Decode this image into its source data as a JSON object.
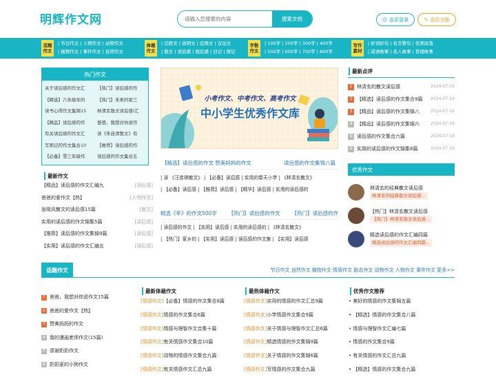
{
  "header": {
    "logo": "明辉作文网",
    "search_placeholder": "请输入您搜索的内容",
    "search_button": "搜索文档",
    "login": "会员登录",
    "register": "会员注册"
  },
  "nav": [
    {
      "tag": "话题作文",
      "links": [
        "| 节日作文 | 人物作文 | 动物作文",
        "| 植物作文 | 事件作文 | 自然作文"
      ]
    },
    {
      "tag": "体裁作文",
      "links": [
        "| 记叙文 | 说明文 | 应用文 | 议论文",
        "| 散文 | 读后感 | 观后感 | 日记 | 周记"
      ]
    },
    {
      "tag": "字数作文",
      "links": [
        "| 100字 | 200字 | 300字 | 400字",
        "| 500字 | 600字 | 700字 | 800字"
      ]
    },
    {
      "tag": "写作素材",
      "links": [
        "| 好词好句 | 名言警句 | 优美段落",
        "| 成语故事 | 名人故事 | 哲理故事"
      ]
    }
  ],
  "hot": {
    "title": "热门作文",
    "items": [
      "关于读后感的作文汇",
      "【热门】读后感的作",
      "【精选】六年级年的",
      "【热门】未来的家三",
      "读书心得作文集锦15",
      "林清玄散文读后感(汇",
      "【精品】读后感的作",
      "爸爸，我想对你说作",
      "有关读后感的作文汇",
      "读《朱自清散文》有",
      "写雨记的作文集合10",
      "【推荐】读后感的作",
      "【必备】雪三年级作",
      "读后感的作文集合五"
    ]
  },
  "latest": {
    "title": "最新作文",
    "items": [
      {
        "text": "【精品】读后感的作文汇编九",
        "tag": "[读后感]"
      },
      {
        "text": "爸爸的爱作文【热】",
        "tag": "[人物作文]"
      },
      {
        "text": "张晓风散文的读后感15篇",
        "tag": "[散文]"
      },
      {
        "text": "实用的读后感的作文锦集5篇",
        "tag": "[读后感]"
      },
      {
        "text": "【推荐】读后感的作文集锦9篇",
        "tag": "[读后感]"
      },
      {
        "text": "【实用】读后感的作文汇编五",
        "tag": "[读后感]"
      }
    ]
  },
  "banner": {
    "line1": "小考作文、中考作文、高考作文",
    "line2": "中小学生优秀作文库"
  },
  "mid": {
    "row1_left": "【精选】读后感的作文  赞美妈妈的作文",
    "row1_right": "读后感的作文集锦八篇",
    "tags1": [
      "| 读 《汪曾祺散文》 | 【必备】读后感 | 实用的春天小学 | 《林清玄散文》",
      "| 【必备】读后感 | 【推荐】读后感 | 【精华】读后感 | 实用的读后感的"
    ],
    "row2": [
      "精选《年》的作文500字",
      "【热门】读后感的作文",
      "【热门】读后感的作"
    ],
    "tags2": [
      "| 读后感的作文 | 【实用】读后感 | 实用的读后感的 | 《林清玄散文》",
      "| 【热门】家乡的 | 【实用】读后感 | 读后感的作文集 | 【实用】读后感"
    ]
  },
  "reviews": {
    "title": "最新点评",
    "items": [
      {
        "n": "1",
        "text": "林清玄的散文读后感",
        "date": "2024-07-19"
      },
      {
        "n": "2",
        "text": "【精选】读后感的作文集合9篇",
        "date": "2024-07-19"
      },
      {
        "n": "3",
        "text": "【精品】读后感的作文集锦八",
        "date": "2024-07-19"
      },
      {
        "n": "4",
        "text": "【精品】读后感的作文集锦六",
        "date": "2024-07-19"
      },
      {
        "n": "5",
        "text": "读后感的作文集合六篇",
        "date": "2024-07-19"
      },
      {
        "n": "6",
        "text": "实用的读后感的作文锦集8篇",
        "date": "2024-07-19"
      }
    ]
  },
  "featured": {
    "title": "优秀作文",
    "items": [
      {
        "title": "林清玄的经典散文读后感",
        "sub": "林清玄的经典散文读后感...",
        "color": "#8a6a4a"
      },
      {
        "title": "【热门】林清玄散文读后感",
        "sub": "【热门】林清玄散文读后感...",
        "color": "#6b4a3a"
      },
      {
        "title": "精选读后感的作文汇编四篇",
        "sub": "精选读后感的作文汇编四篇...",
        "color": "#3a4a7a"
      }
    ]
  },
  "topic": {
    "title": "话题作文",
    "links": "节日作文  自然作文  植物作文  情感作文  励志作文  动物作文  人物作文  事件作文  更多>>",
    "left_items": [
      {
        "n": "1",
        "text": "爸爸，我想对你说作文15篇"
      },
      {
        "n": "2",
        "text": "爸爸的爱作文【热】"
      },
      {
        "n": "3",
        "text": "赞美妈妈的作文"
      },
      {
        "n": "4",
        "text": "我的漫画老师作文(15篇)"
      },
      {
        "n": "5",
        "text": "感谢奶奶作文"
      },
      {
        "n": "6",
        "text": "奶奶家的小狗作文"
      }
    ],
    "col2_title": "最新体裁作文",
    "col2": [
      {
        "tag": "[情感作文]",
        "text": "【必备】情感的作文集合8篇"
      },
      {
        "tag": "[情感作文]",
        "text": "情感的作文集合6篇"
      },
      {
        "tag": "[情感作文]",
        "text": "情感与理智作文合集十篇"
      },
      {
        "tag": "[情感作文]",
        "text": "有关情感作文集合10篇"
      },
      {
        "tag": "[情感作文]",
        "text": "动物的情感作文集合九篇"
      },
      {
        "tag": "[情感作文]",
        "text": "有关情感作文汇总九篇"
      }
    ],
    "col3_title": "最热体裁作文",
    "col3": [
      {
        "tag": "[情感作文]",
        "text": "实用的情感的作文汇总9篇"
      },
      {
        "tag": "[情感作文]",
        "text": "小学情感作文集合9篇"
      },
      {
        "tag": "[情感作文]",
        "text": "关于情感与理智作文汇总6篇"
      },
      {
        "tag": "[情感作文]",
        "text": "精选情感的作文集锦9篇"
      },
      {
        "tag": "[情感作文]",
        "text": "关于情感的作文集锦6篇"
      },
      {
        "tag": "[情感作文]",
        "text": "写情感的作文集合九篇"
      }
    ],
    "col4_title": "优秀作文推荐",
    "col4": [
      "美好的情感的作文集锦五篇",
      "【精选】情感的作文集合八篇",
      "情感与理智作文汇编七篇",
      "情感的作文集合9篇",
      "有关情感的作文汇总九篇",
      "【精选】情感的作文集合九篇"
    ]
  }
}
